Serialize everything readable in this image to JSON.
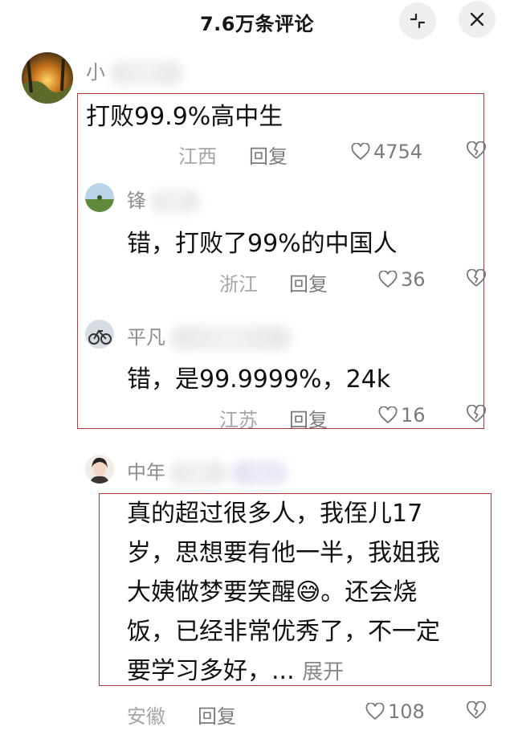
{
  "header": {
    "title": "7.6万条评论",
    "icons": [
      "minimize-icon",
      "close-icon"
    ]
  },
  "comments": [
    {
      "name": "小",
      "content": "打败99.9%高中生",
      "location": "江西",
      "reply_label": "回复",
      "likes": "4754",
      "replies": [
        {
          "name": "锋",
          "content": "错，打败了99%的中国人",
          "location": "浙江",
          "reply_label": "回复",
          "likes": "36"
        },
        {
          "name": "平凡",
          "content": "错，是99.9999%，24k",
          "location": "江苏",
          "reply_label": "回复",
          "likes": "16"
        }
      ]
    },
    {
      "name": "中年",
      "content": [
        "真的超过很多人，我侄儿17",
        "岁，思想要有他一半，我姐我",
        "大姨做梦要笑醒😅。还会烧",
        "饭，已经非常优秀了，不一定",
        "要学习多好，..."
      ],
      "expand_label": "展开",
      "location": "安徽",
      "reply_label": "回复",
      "likes": "108"
    }
  ],
  "colors": {
    "highlight_box": "#b03a3a",
    "meta_text": "#a6a6a6"
  }
}
